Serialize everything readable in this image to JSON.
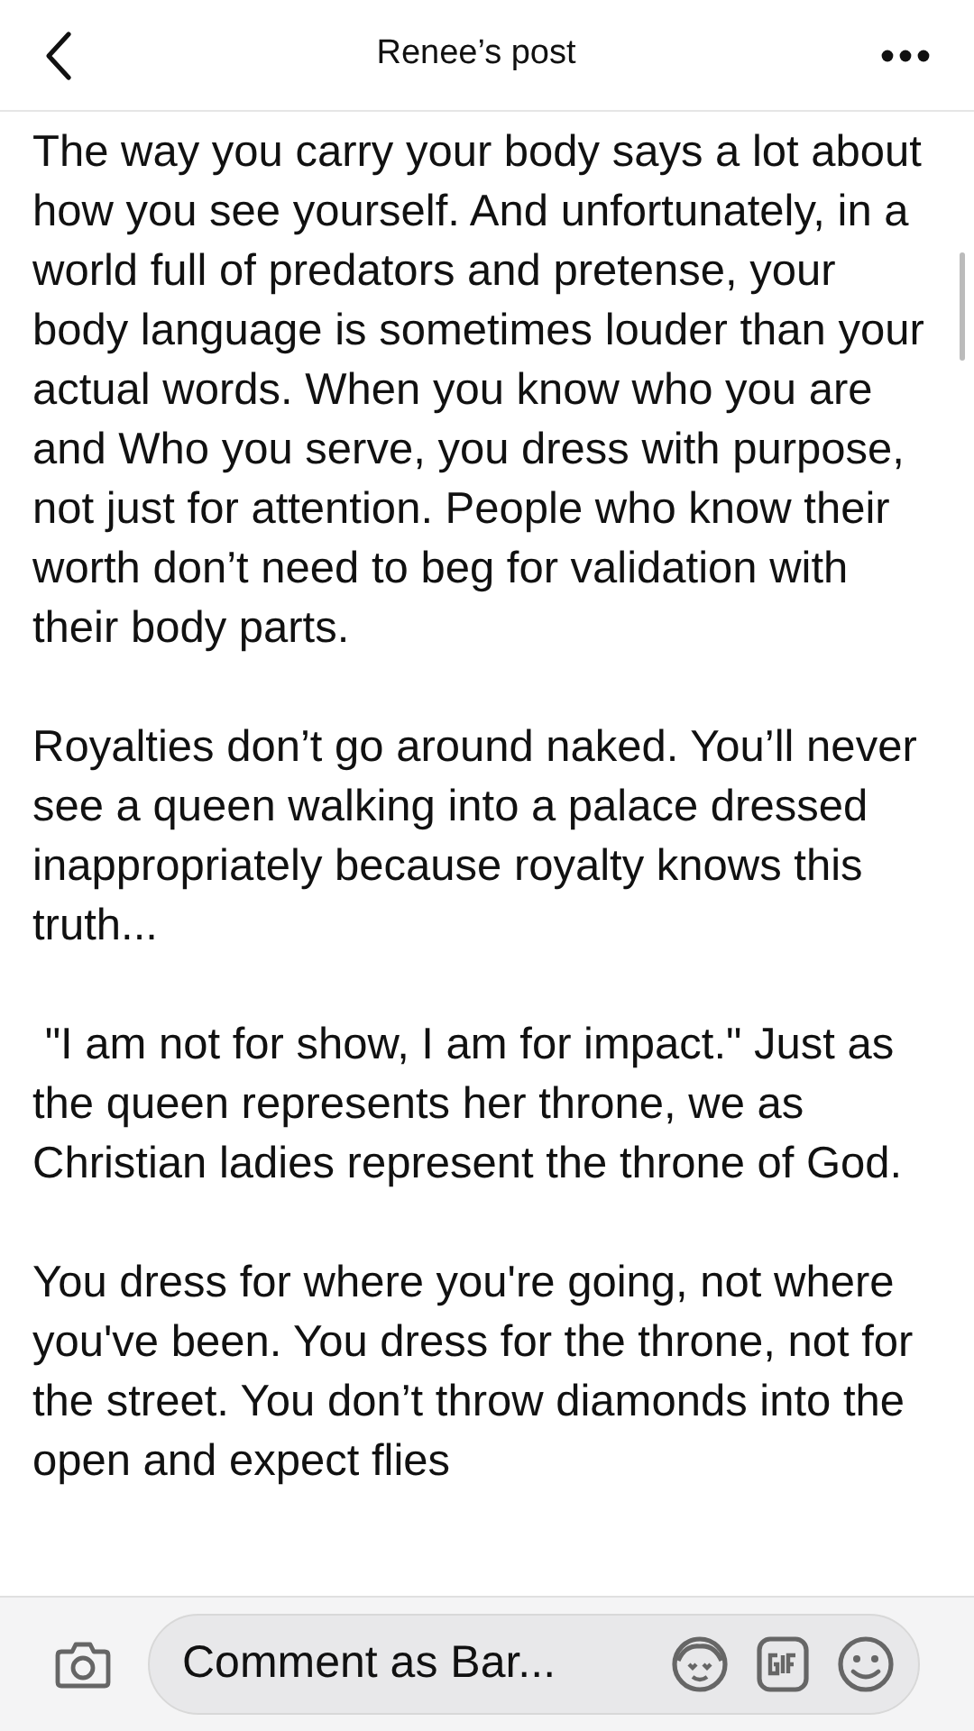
{
  "header": {
    "title": "Renee’s post"
  },
  "post": {
    "paragraphs": [
      "The way you carry your body says a lot about how you see yourself. And unfortunately, in a world full of predators and pretense, your body language is sometimes louder than your actual words. When you know who you are and Who you serve, you dress with purpose, not just for attention. People who know their worth don’t need to beg for validation with their body parts.",
      "Royalties don’t go around naked. You’ll never see a queen walking into a palace dressed inappropriately because royalty knows this truth...",
      " \"I am not for show, I am for impact.\" Just as the queen represents her throne, we as Christian ladies represent the throne of God.",
      "You dress for where you're going, not where you've been. You dress for the throne, not for the street. You don’t throw diamonds into the open and expect flies"
    ]
  },
  "comment_bar": {
    "placeholder": "Comment as Bar..."
  }
}
